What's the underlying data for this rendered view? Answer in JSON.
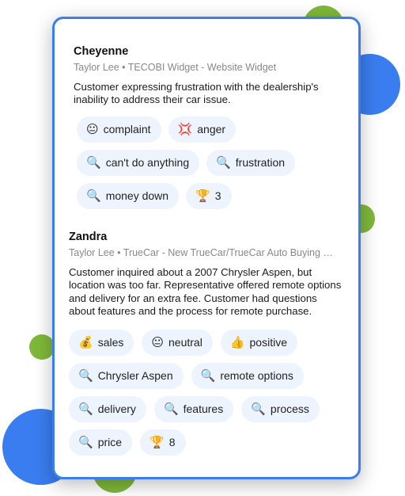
{
  "colors": {
    "accent_blue": "#3a7df0",
    "accent_green": "#7fb83a",
    "tag_bg": "#eef4fd"
  },
  "entries": [
    {
      "name": "Cheyenne",
      "meta": "Taylor Lee • TECOBI Widget - Website Widget",
      "summary": "Customer expressing frustration with the dealership's inability to address their car issue.",
      "tags": [
        {
          "icon": "neutral-face-icon",
          "glyph": "😐",
          "label": "complaint"
        },
        {
          "icon": "anger-symbol-icon",
          "glyph": "💢",
          "label": "anger"
        },
        {
          "icon": "magnifier-icon",
          "glyph": "🔍",
          "label": "can't do anything"
        },
        {
          "icon": "magnifier-icon",
          "glyph": "🔍",
          "label": "frustration"
        },
        {
          "icon": "magnifier-icon",
          "glyph": "🔍",
          "label": "money down"
        },
        {
          "icon": "trophy-icon",
          "glyph": "🏆",
          "label": "3"
        }
      ]
    },
    {
      "name": "Zandra",
      "meta": "Taylor Lee • TrueCar - New TrueCar/TrueCar Auto Buying …",
      "summary": "Customer inquired about a 2007 Chrysler Aspen, but location was too far. Representative offered remote options and delivery for an extra fee. Customer had questions about features and the process for remote purchase.",
      "tags": [
        {
          "icon": "money-bag-icon",
          "glyph": "💰",
          "label": "sales"
        },
        {
          "icon": "neutral-face-icon",
          "glyph": "😐",
          "label": "neutral"
        },
        {
          "icon": "thumbs-up-icon",
          "glyph": "👍",
          "label": "positive"
        },
        {
          "icon": "magnifier-icon",
          "glyph": "🔍",
          "label": "Chrysler Aspen"
        },
        {
          "icon": "magnifier-icon",
          "glyph": "🔍",
          "label": "remote options"
        },
        {
          "icon": "magnifier-icon",
          "glyph": "🔍",
          "label": "delivery"
        },
        {
          "icon": "magnifier-icon",
          "glyph": "🔍",
          "label": "features"
        },
        {
          "icon": "magnifier-icon",
          "glyph": "🔍",
          "label": "process"
        },
        {
          "icon": "magnifier-icon",
          "glyph": "🔍",
          "label": "price"
        },
        {
          "icon": "trophy-icon",
          "glyph": "🏆",
          "label": "8"
        }
      ]
    }
  ]
}
